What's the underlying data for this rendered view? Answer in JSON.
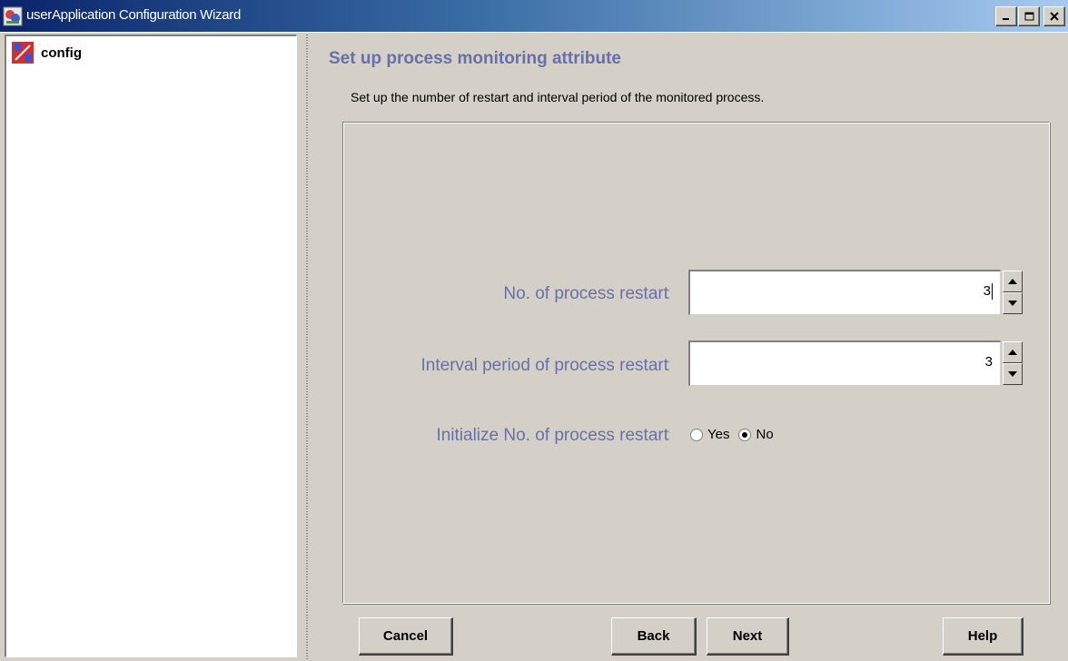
{
  "window": {
    "title": "userApplication Configuration Wizard",
    "controls": [
      "minimize",
      "maximize",
      "close"
    ]
  },
  "tree": {
    "items": [
      {
        "label": "config",
        "icon": "config-node-icon"
      }
    ]
  },
  "main": {
    "heading": "Set up process monitoring attribute",
    "description": "Set up the number of restart and interval period of the monitored process.",
    "fields": {
      "restart_count": {
        "label": "No. of process restart",
        "colon": ":",
        "value": "3"
      },
      "interval": {
        "label": "Interval period of process restart",
        "colon": ":",
        "value": "3"
      },
      "initialize": {
        "label": "Initialize No. of process restart",
        "colon": ":",
        "options": [
          {
            "label": "Yes",
            "checked": false
          },
          {
            "label": "No",
            "checked": true
          }
        ]
      }
    }
  },
  "buttons": {
    "cancel": "Cancel",
    "back": "Back",
    "next": "Next",
    "help": "Help"
  },
  "colors": {
    "title_bar": "#0a246a",
    "heading": "#6870a8",
    "background": "#d4d0c8"
  }
}
